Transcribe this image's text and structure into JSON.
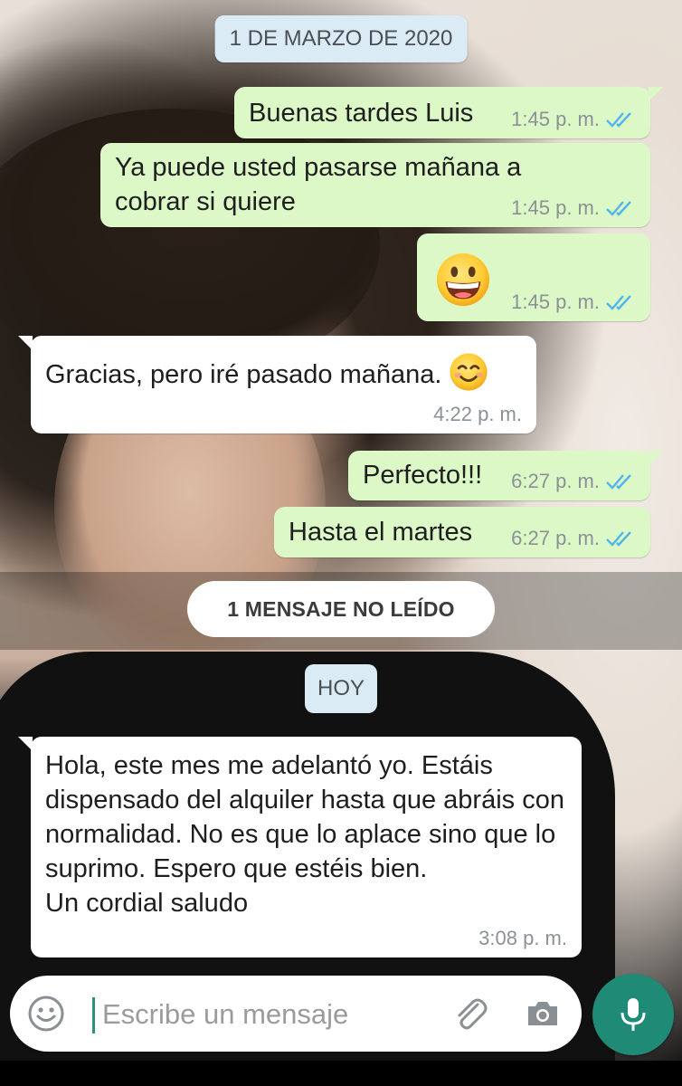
{
  "chat": {
    "date_divider": "1 DE MARZO DE 2020",
    "messages": [
      {
        "direction": "out",
        "text": "Buenas tardes Luis",
        "time": "1:45 p. m.",
        "status": "read-ticks-icon"
      },
      {
        "direction": "out",
        "text": "Ya puede usted pasarse mañana a cobrar si quiere",
        "time": "1:45 p. m.",
        "status": "read-ticks-icon"
      },
      {
        "direction": "out",
        "emoji": "grinning-face-icon",
        "time": "1:45 p. m.",
        "status": "read-ticks-icon"
      },
      {
        "direction": "in",
        "text": "Gracias, pero iré pasado mañana.",
        "emoji": "smiling-face-icon",
        "time": "4:22 p. m."
      },
      {
        "direction": "out",
        "text": "Perfecto!!!",
        "time": "6:27 p. m.",
        "status": "read-ticks-icon"
      },
      {
        "direction": "out",
        "text": "Hasta el martes",
        "time": "6:27 p. m.",
        "status": "read-ticks-icon"
      }
    ],
    "unread_banner": "1 MENSAJE NO LEÍDO",
    "today_divider": "HOY",
    "latest_message": {
      "direction": "in",
      "text": "Hola, este mes me adelantó yo. Estáis dispensado del alquiler hasta que abráis con normalidad. No es que lo aplace sino que lo suprimo. Espero que estéis bien.\nUn cordial saludo",
      "time": "3:08 p. m."
    }
  },
  "composer": {
    "placeholder": "Escribe un mensaje",
    "icons": [
      "emoji-icon",
      "attach-icon",
      "camera-icon",
      "mic-icon"
    ]
  },
  "colors": {
    "outgoing_bubble": "#dcf8c6",
    "incoming_bubble": "#ffffff",
    "date_chip": "#dbebf5",
    "read_ticks": "#4fb6ec",
    "mic_button": "#1f8a76"
  }
}
